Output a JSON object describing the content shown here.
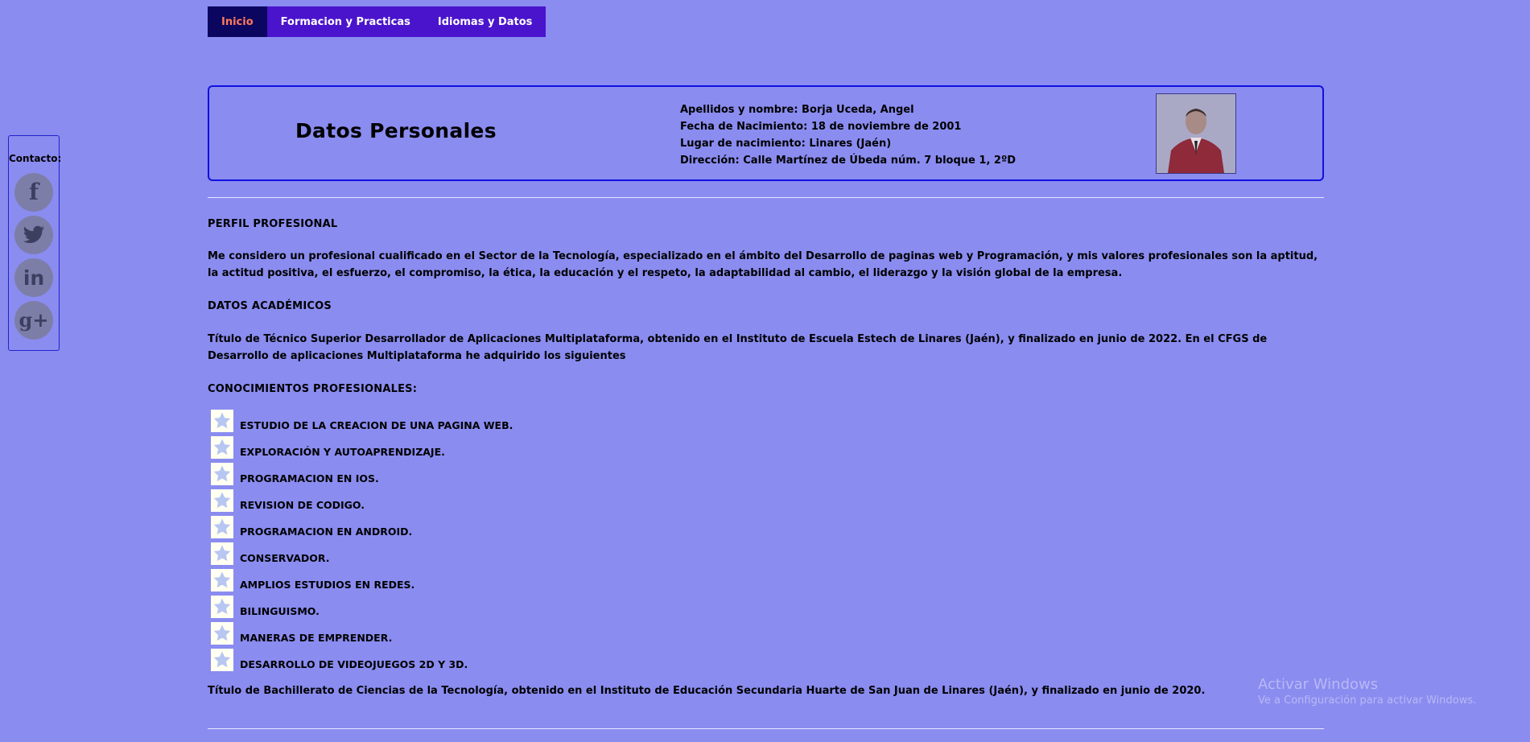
{
  "nav": {
    "items": [
      {
        "label": "Inicio",
        "active": true
      },
      {
        "label": "Formacion y Practicas",
        "active": false
      },
      {
        "label": "Idiomas y Datos",
        "active": false
      }
    ]
  },
  "contact": {
    "title": "Contacto:",
    "social": [
      {
        "icon": "facebook-icon",
        "glyph": "f"
      },
      {
        "icon": "twitter-icon",
        "glyph": "🐦"
      },
      {
        "icon": "linkedin-icon",
        "glyph": "in"
      },
      {
        "icon": "googleplus-icon",
        "glyph": "g+"
      }
    ]
  },
  "header": {
    "title": "Datos Personales",
    "lines": [
      "Apellidos y nombre: Borja Uceda, Angel",
      "Fecha de Nacimiento: 18 de noviembre de 2001",
      "Lugar de nacimiento: Linares (Jaén)",
      "Dirección: Calle Martínez de Úbeda núm. 7 bloque 1, 2ºD"
    ]
  },
  "profile": {
    "title": "PERFIL PROFESIONAL",
    "text": "Me considero un profesional cualificado en el Sector de la Tecnología, especializado en el ámbito del Desarrollo de paginas web y Programación, y mis valores profesionales son la aptitud, la actitud positiva, el esfuerzo, el compromiso, la ética, la educación y el respeto, la adaptabilidad al cambio, el liderazgo y la visión global de la empresa."
  },
  "academic": {
    "title": "DATOS ACADÉMICOS",
    "text": "Título de Técnico Superior Desarrollador de Aplicaciones Multiplataforma, obtenido en el Instituto de Escuela Estech de Linares (Jaén), y finalizado en junio de 2022. En el CFGS de Desarrollo de aplicaciones Multiplataforma he adquirido los siguientes"
  },
  "knowledge": {
    "title": "CONOCIMIENTOS PROFESIONALES:",
    "items": [
      "ESTUDIO DE LA CREACION DE UNA PAGINA WEB.",
      "EXPLORACIÓN Y AUTOAPRENDIZAJE.",
      "PROGRAMACION EN IOS.",
      "REVISION DE CODIGO.",
      "PROGRAMACION EN ANDROID.",
      "CONSERVADOR.",
      "AMPLIOS ESTUDIOS EN REDES.",
      "BILINGUISMO.",
      "MANERAS DE EMPRENDER.",
      "DESARROLLO DE VIDEOJUEGOS 2D Y 3D."
    ],
    "footer": "Título de Bachillerato de Ciencias de la Tecnología, obtenido en el Instituto de Educación Secundaria Huarte de San Juan de Linares (Jaén), y finalizado en junio de 2020."
  },
  "watermark": {
    "title": "Activar Windows",
    "subtitle": "Ve a Configuración para activar Windows."
  },
  "colors": {
    "background": "#8a8cf0",
    "nav": "#4a14cc",
    "nav_active": "#0b0660",
    "nav_active_text": "#ff7a59",
    "border": "#1010e0"
  }
}
